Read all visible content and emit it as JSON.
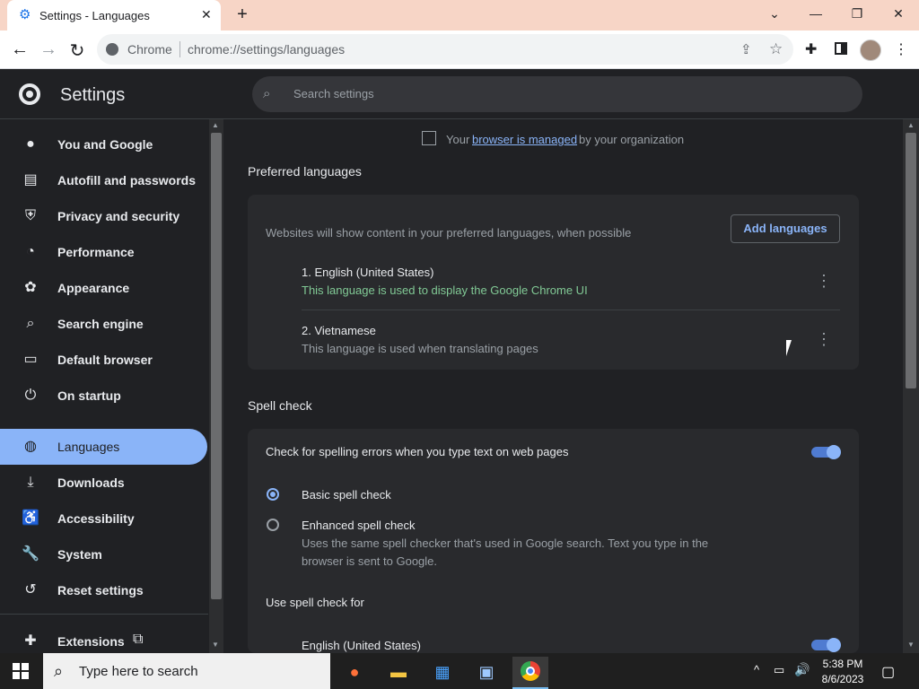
{
  "browser": {
    "tab_title": "Settings - Languages",
    "omnibox_label": "Chrome",
    "url": "chrome://settings/languages"
  },
  "settings": {
    "title": "Settings",
    "search_placeholder": "Search settings"
  },
  "sidebar": {
    "items": [
      {
        "label": "You and Google",
        "icon": "person-icon"
      },
      {
        "label": "Autofill and passwords",
        "icon": "clipboard-icon"
      },
      {
        "label": "Privacy and security",
        "icon": "shield-icon"
      },
      {
        "label": "Performance",
        "icon": "gauge-icon"
      },
      {
        "label": "Appearance",
        "icon": "palette-icon"
      },
      {
        "label": "Search engine",
        "icon": "search-icon"
      },
      {
        "label": "Default browser",
        "icon": "browser-icon"
      },
      {
        "label": "On startup",
        "icon": "power-icon"
      },
      {
        "label": "Languages",
        "icon": "globe-icon",
        "active": true
      },
      {
        "label": "Downloads",
        "icon": "download-icon"
      },
      {
        "label": "Accessibility",
        "icon": "accessibility-icon"
      },
      {
        "label": "System",
        "icon": "wrench-icon"
      },
      {
        "label": "Reset settings",
        "icon": "reset-icon"
      },
      {
        "label": "Extensions",
        "icon": "puzzle-icon"
      }
    ]
  },
  "managed": {
    "prefix": "Your",
    "link": "browser is managed",
    "suffix": "by your organization"
  },
  "preferred": {
    "title": "Preferred languages",
    "description": "Websites will show content in your preferred languages, when possible",
    "add_button": "Add languages",
    "languages": [
      {
        "name": "1. English (United States)",
        "note": "This language is used to display the Google Chrome UI"
      },
      {
        "name": "2. Vietnamese",
        "note": "This language is used when translating pages"
      }
    ]
  },
  "spellcheck": {
    "title": "Spell check",
    "toggle_label": "Check for spelling errors when you type text on web pages",
    "toggle_on": true,
    "basic_label": "Basic spell check",
    "basic_selected": true,
    "enhanced_label": "Enhanced spell check",
    "enhanced_desc_line1": "Uses the same spell checker that's used in Google search. Text you type in the",
    "enhanced_desc_line2": "browser is sent to Google.",
    "use_for_title": "Use spell check for",
    "use_for_language": "English (United States)",
    "use_for_on": true
  },
  "taskbar": {
    "search_placeholder": "Type here to search",
    "time": "5:38 PM",
    "date": "8/6/2023"
  },
  "colors": {
    "accent": "#8ab4f8",
    "green_note": "#81c995",
    "background": "#202124",
    "card": "#292a2d"
  }
}
